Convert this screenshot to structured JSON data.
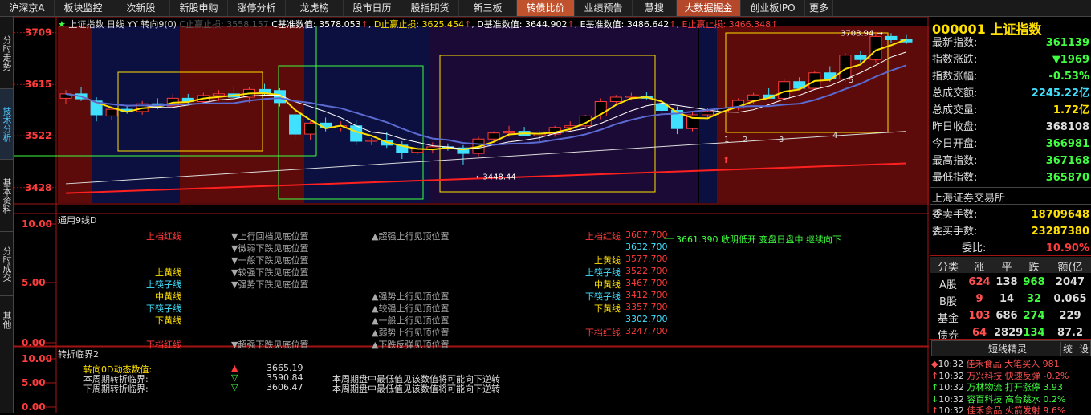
{
  "topbar": {
    "tabs": [
      {
        "label": "沪深京A",
        "w": 68,
        "hl": 0
      },
      {
        "label": "板块监控",
        "w": 72,
        "hl": 0
      },
      {
        "label": "次新股",
        "w": 72,
        "hl": 0
      },
      {
        "label": "新股申购",
        "w": 72,
        "hl": 0
      },
      {
        "label": "涨停分析",
        "w": 72,
        "hl": 0
      },
      {
        "label": "龙虎榜",
        "w": 72,
        "hl": 0
      },
      {
        "label": "股市日历",
        "w": 72,
        "hl": 0
      },
      {
        "label": "股指期货",
        "w": 72,
        "hl": 0
      },
      {
        "label": "新三板",
        "w": 72,
        "hl": 0
      },
      {
        "label": "转债比价",
        "w": 72,
        "hl": 1
      },
      {
        "label": "业绩预告",
        "w": 72,
        "hl": 0
      },
      {
        "label": "慧搜",
        "w": 55,
        "hl": 0
      },
      {
        "label": "大数据掘金",
        "w": 80,
        "hl": 2
      },
      {
        "label": "创业板IPO",
        "w": 80,
        "hl": 0
      },
      {
        "label": "更多",
        "w": 35,
        "hl": 0
      }
    ]
  },
  "lefttabs": [
    {
      "label": "分时走势",
      "active": false
    },
    {
      "label": "技术分析",
      "active": true
    },
    {
      "label": "基本资料",
      "active": false
    },
    {
      "label": "分时成交",
      "active": false
    },
    {
      "label": "其他",
      "active": false
    }
  ],
  "header": {
    "name": "上证指数",
    "period": "日线",
    "indicator": "转向9(0)",
    "c_stop": "C止赢止损: 3558.157",
    "c_base": "C基准数值: 3578.053",
    "d_stop": "D止赢止损: 3625.454",
    "d_base": "D基准数值: 3644.902",
    "e_base": "E基准数值: 3486.642",
    "e_stop": "E止赢止损: 3466.348"
  },
  "chart_data": {
    "type": "candlestick",
    "yticks": [
      "3709",
      "3615",
      "3522",
      "3428"
    ],
    "ylim": [
      3400,
      3720
    ],
    "annotations": {
      "high": "3708.94",
      "low": "3448.44",
      "marks": [
        "1",
        "2",
        "3",
        "4",
        "5"
      ]
    },
    "ohlc": [
      [
        3590,
        3605,
        3580,
        3598
      ],
      [
        3598,
        3610,
        3585,
        3589
      ],
      [
        3585,
        3592,
        3548,
        3560
      ],
      [
        3558,
        3575,
        3550,
        3570
      ],
      [
        3570,
        3578,
        3562,
        3566
      ],
      [
        3566,
        3585,
        3560,
        3580
      ],
      [
        3580,
        3590,
        3570,
        3576
      ],
      [
        3576,
        3598,
        3572,
        3590
      ],
      [
        3590,
        3598,
        3578,
        3584
      ],
      [
        3584,
        3600,
        3580,
        3595
      ],
      [
        3595,
        3605,
        3585,
        3598
      ],
      [
        3598,
        3612,
        3588,
        3592
      ],
      [
        3592,
        3610,
        3582,
        3606
      ],
      [
        3606,
        3616,
        3596,
        3600
      ],
      [
        3604,
        3608,
        3575,
        3582
      ],
      [
        3560,
        3565,
        3515,
        3525
      ],
      [
        3525,
        3548,
        3515,
        3545
      ],
      [
        3545,
        3555,
        3530,
        3536
      ],
      [
        3536,
        3548,
        3530,
        3540
      ],
      [
        3540,
        3550,
        3505,
        3512
      ],
      [
        3512,
        3518,
        3505,
        3514
      ],
      [
        3514,
        3528,
        3500,
        3505
      ],
      [
        3505,
        3512,
        3480,
        3492
      ],
      [
        3492,
        3502,
        3488,
        3498
      ],
      [
        3498,
        3510,
        3490,
        3502
      ],
      [
        3502,
        3508,
        3495,
        3500
      ],
      [
        3500,
        3505,
        3470,
        3490
      ],
      [
        3490,
        3520,
        3485,
        3516
      ],
      [
        3516,
        3530,
        3510,
        3527
      ],
      [
        3527,
        3540,
        3520,
        3530
      ],
      [
        3530,
        3538,
        3522,
        3522
      ],
      [
        3522,
        3530,
        3512,
        3525
      ],
      [
        3525,
        3540,
        3520,
        3537
      ],
      [
        3537,
        3548,
        3530,
        3540
      ],
      [
        3540,
        3560,
        3535,
        3558
      ],
      [
        3558,
        3590,
        3552,
        3584
      ],
      [
        3584,
        3596,
        3580,
        3592
      ],
      [
        3592,
        3600,
        3586,
        3594
      ],
      [
        3594,
        3602,
        3588,
        3590
      ],
      [
        3580,
        3585,
        3560,
        3568
      ],
      [
        3568,
        3575,
        3525,
        3535
      ],
      [
        3535,
        3565,
        3530,
        3560
      ],
      [
        3560,
        3572,
        3552,
        3566
      ],
      [
        3566,
        3578,
        3560,
        3572
      ],
      [
        3572,
        3590,
        3568,
        3586
      ],
      [
        3586,
        3600,
        3580,
        3596
      ],
      [
        3596,
        3608,
        3590,
        3590
      ],
      [
        3590,
        3625,
        3588,
        3620
      ],
      [
        3620,
        3628,
        3605,
        3608
      ],
      [
        3608,
        3640,
        3605,
        3636
      ],
      [
        3636,
        3648,
        3620,
        3625
      ],
      [
        3625,
        3672,
        3620,
        3668
      ],
      [
        3668,
        3676,
        3655,
        3660
      ],
      [
        3660,
        3710,
        3655,
        3702
      ],
      [
        3702,
        3708,
        3690,
        3696
      ],
      [
        3696,
        3706,
        3688,
        3692
      ]
    ]
  },
  "panel2": {
    "title": "通用9线D",
    "yticks": [
      "10.00",
      "5.00",
      "0.00"
    ],
    "left_labels": [
      {
        "t": "上档红线",
        "c": "#ff3b3b"
      },
      {
        "t": "",
        "c": "#fff"
      },
      {
        "t": "",
        "c": "#fff"
      },
      {
        "t": "上黄线",
        "c": "#ffe000"
      },
      {
        "t": "上筷子线",
        "c": "#40e0ff"
      },
      {
        "t": "中黄线",
        "c": "#ffe000"
      },
      {
        "t": "下筷子线",
        "c": "#40e0ff"
      },
      {
        "t": "下黄线",
        "c": "#ffe000"
      },
      {
        "t": "",
        "c": "#fff"
      },
      {
        "t": "下档红线",
        "c": "#ff3b3b"
      }
    ],
    "mid_labels": [
      "▼上行回档见底位置",
      "▼微弱下跌见底位置",
      "▼一般下跌见底位置",
      "▼较强下跌见底位置",
      "▼强势下跌见底位置",
      "",
      "",
      "",
      "",
      "▼超强下跌见底位置"
    ],
    "mid2_labels": [
      "▲超强上行见顶位置",
      "",
      "",
      "",
      "",
      "▲强势上行见顶位置",
      "▲较强上行见顶位置",
      "▲一般上行见顶位置",
      "▲弱势上行见顶位置",
      "▲下跌反弹见顶位置"
    ],
    "right_labels": [
      {
        "t": "上档红线",
        "c": "#ff3b3b",
        "v": "3687.700"
      },
      {
        "t": "",
        "c": "#fff",
        "v": "3632.700"
      },
      {
        "t": "上黄线",
        "c": "#ffe000",
        "v": "3577.700"
      },
      {
        "t": "上筷子线",
        "c": "#40e0ff",
        "v": "3522.700"
      },
      {
        "t": "中黄线",
        "c": "#ffe000",
        "v": "3467.700"
      },
      {
        "t": "下筷子线",
        "c": "#40e0ff",
        "v": "3412.700"
      },
      {
        "t": "下黄线",
        "c": "#ffe000",
        "v": "3357.700"
      },
      {
        "t": "",
        "c": "#fff",
        "v": "3302.700"
      },
      {
        "t": "下档红线",
        "c": "#ff3b3b",
        "v": "3247.700"
      }
    ],
    "note": "3661.390 收阴低开 变盘日盘中 继续向下"
  },
  "panel3": {
    "title": "转折临界2",
    "yticks": [
      "10.00",
      "5.00",
      "0.00"
    ],
    "rows": [
      {
        "k": "转向0D动态数值:",
        "v": "3665.19",
        "sym": "▲",
        "note": ""
      },
      {
        "k": "本周期转折临界:",
        "v": "3590.84",
        "sym": "▽",
        "note": "本周期盘中最低值见该数值将可能向下逆转"
      },
      {
        "k": "下周期转折临界:",
        "v": "3606.47",
        "sym": "▽",
        "note": "本周期盘中最低值见该数值将可能向下逆转"
      }
    ]
  },
  "rpanel": {
    "code": "000001",
    "name": "上证指数",
    "rows": [
      {
        "k": "最新指数:",
        "v": "361139",
        "c": "#40ff40"
      },
      {
        "k": "指数涨跌:",
        "v": "▼1969",
        "c": "#40ff40"
      },
      {
        "k": "指数涨幅:",
        "v": "-0.53%",
        "c": "#40ff40"
      },
      {
        "k": "总成交额:",
        "v": "2245.22亿",
        "c": "#40e0ff"
      },
      {
        "k": "总成交量:",
        "v": "1.72亿",
        "c": "#ffe000"
      },
      {
        "k": "昨日收盘:",
        "v": "368108",
        "c": "#ddd"
      },
      {
        "k": "今日开盘:",
        "v": "366981",
        "c": "#40ff40"
      },
      {
        "k": "最高指数:",
        "v": "367168",
        "c": "#40ff40"
      },
      {
        "k": "最低指数:",
        "v": "365870",
        "c": "#40ff40"
      }
    ],
    "exchange": "上海证券交易所",
    "rows2": [
      {
        "k": "委卖手数:",
        "v": "18709648",
        "c": "#ffe000"
      },
      {
        "k": "委买手数:",
        "v": "23287380",
        "c": "#ffe000"
      },
      {
        "k": "委比:",
        "v": "10.90%",
        "c": "#ff3b3b"
      }
    ],
    "table_head": [
      "分类",
      "涨",
      "平",
      "跌",
      "额(亿"
    ],
    "table": [
      [
        "A股",
        "624",
        "138",
        "968",
        "2047"
      ],
      [
        "B股",
        "9",
        "14",
        "32",
        "0.065"
      ],
      [
        "基金",
        "103",
        "686",
        "274",
        "229"
      ],
      [
        "债券",
        "64",
        "2829",
        "134",
        "87.2"
      ]
    ],
    "sprite_title": "短线精灵",
    "sprite_tabs": [
      "统",
      "设"
    ],
    "sprite": [
      {
        "s": "◆",
        "t": "10:32",
        "n": "佳禾食品",
        "e": "大笔买入",
        "v": "981",
        "c": "#ff5050"
      },
      {
        "s": "↑",
        "t": "10:32",
        "n": "万兴科技",
        "e": "快速反弹",
        "v": "-0.2%",
        "c": "#ff5050"
      },
      {
        "s": "↑",
        "t": "10:32",
        "n": "万林物流",
        "e": "打开涨停",
        "v": "3.93",
        "c": "#40ff40"
      },
      {
        "s": "↓",
        "t": "10:32",
        "n": "容百科技",
        "e": "高台跳水",
        "v": "0.2%",
        "c": "#40ff40"
      },
      {
        "s": "↑",
        "t": "10:32",
        "n": "佳禾食品",
        "e": "火箭发射",
        "v": "9.6%",
        "c": "#ff5050"
      }
    ]
  }
}
